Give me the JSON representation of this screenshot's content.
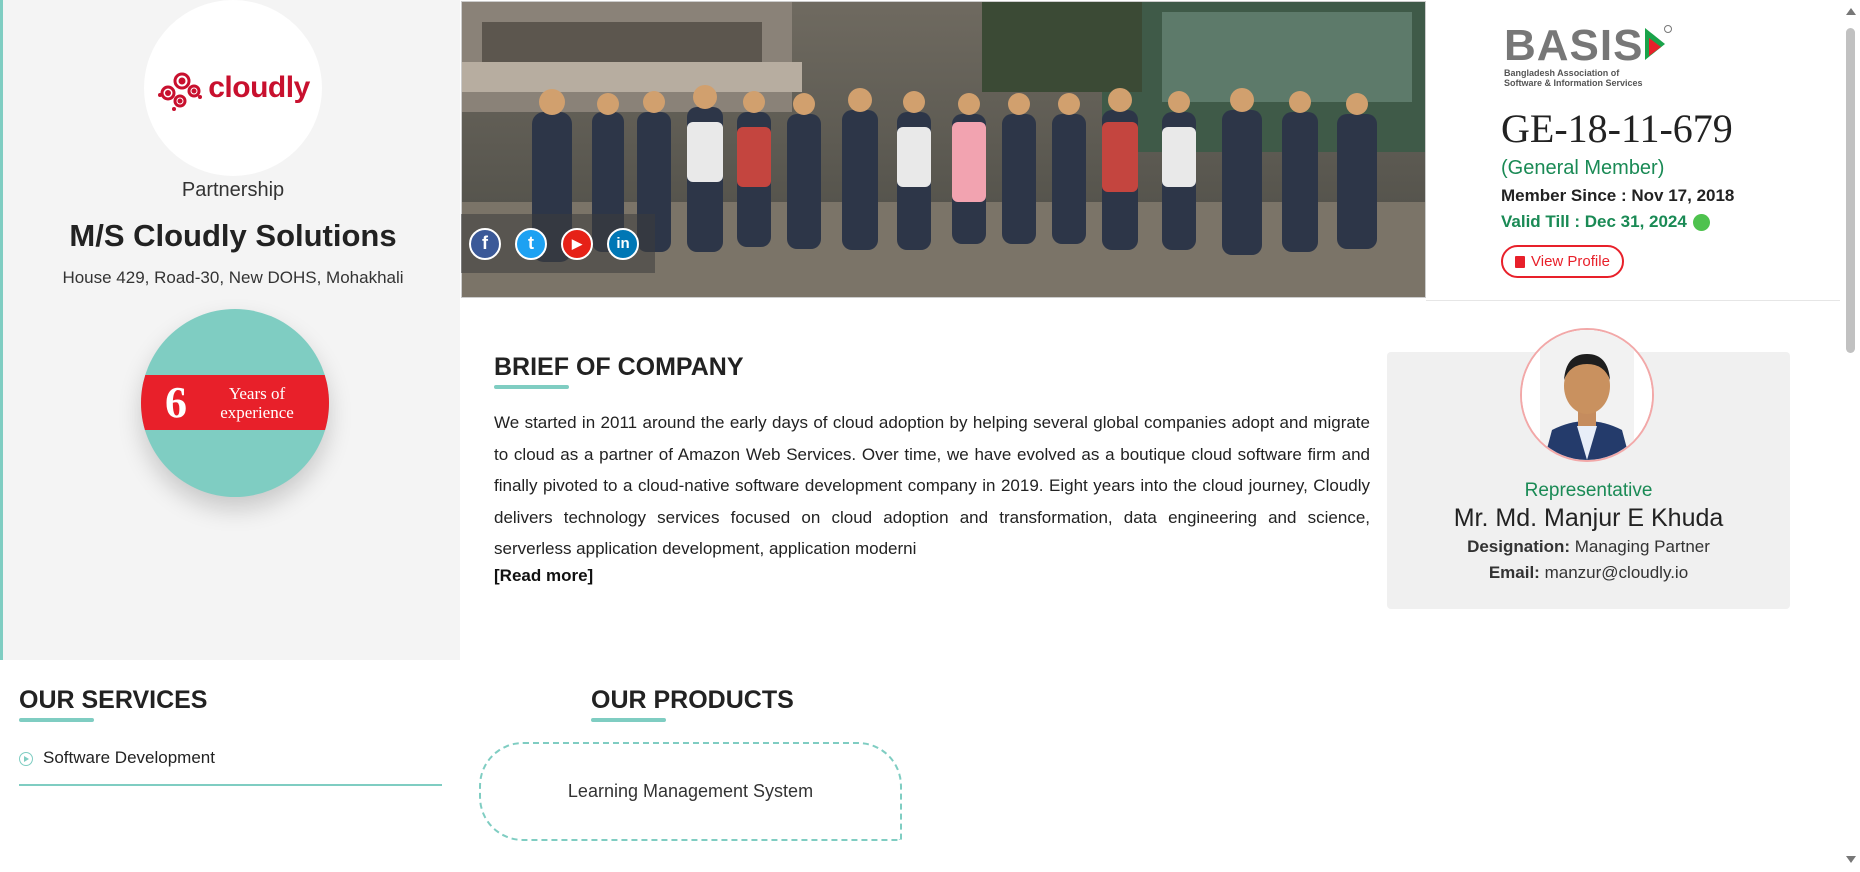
{
  "company": {
    "logo_text": "cloudly",
    "type": "Partnership",
    "name": "M/S Cloudly Solutions",
    "address": "House 429, Road-30, New DOHS, Mohakhali",
    "experience_years": "6",
    "experience_label_line1": "Years of",
    "experience_label_line2": "experience"
  },
  "social": [
    {
      "name": "facebook",
      "glyph": "f"
    },
    {
      "name": "twitter",
      "glyph": "t"
    },
    {
      "name": "youtube",
      "glyph": "▶"
    },
    {
      "name": "linkedin",
      "glyph": "in"
    }
  ],
  "membership": {
    "basis_word": "BASIS",
    "basis_sub1": "Bangladesh Association of",
    "basis_sub2": "Software & Information Services",
    "member_id": "GE-18-11-679",
    "member_type": "(General Member)",
    "member_since": "Member Since : Nov 17, 2018",
    "valid_till": "Valid Till : Dec 31, 2024",
    "view_profile_label": "View Profile"
  },
  "brief": {
    "title": "BRIEF OF COMPANY",
    "text": "We started in 2011 around the early days of cloud adoption by helping several global companies adopt and migrate to cloud as a partner of Amazon Web Services. Over time, we have evolved as a boutique cloud software firm and finally pivoted to a cloud-native software development company in 2019. Eight years into the cloud journey, Cloudly delivers technology services focused on cloud adoption and transformation, data engineering and science, serverless application development, application moderni",
    "read_more": "[Read more]"
  },
  "representative": {
    "role": "Representative",
    "name": "Mr. Md. Manjur E Khuda",
    "designation_label": "Designation:",
    "designation": "Managing Partner",
    "email_label": "Email:",
    "email": "manzur@cloudly.io"
  },
  "services": {
    "title": "OUR SERVICES",
    "items": [
      "Software Development"
    ]
  },
  "products": {
    "title": "OUR PRODUCTS",
    "items": [
      "Learning Management System"
    ]
  },
  "colors": {
    "accent_teal": "#7fcdc2",
    "brand_red": "#e8202a",
    "member_green": "#1a8a55"
  }
}
